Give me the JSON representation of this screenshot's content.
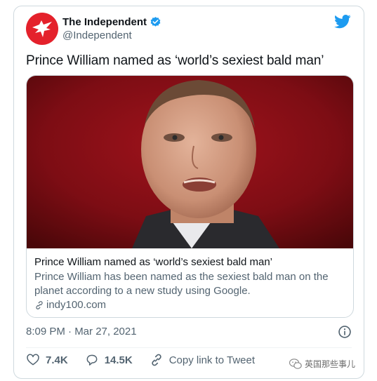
{
  "tweet": {
    "author_name": "The Independent",
    "handle": "@Independent",
    "text": "Prince William named as ‘world’s sexiest bald man’",
    "timestamp": "8:09 PM · Mar 27, 2021"
  },
  "link_card": {
    "title": "Prince William named as ‘world’s sexiest bald man’",
    "description": "Prince William has been named as the sexiest bald man on the planet according to a new study using Google.",
    "domain": "indy100.com"
  },
  "actions": {
    "likes": "7.4K",
    "replies": "14.5K",
    "copy_link_label": "Copy link to Tweet"
  },
  "watermark": {
    "text": "英国那些事儿"
  },
  "colors": {
    "brand_red": "#e4212b",
    "twitter_blue": "#1d9bf0",
    "muted_text": "#536471",
    "border": "#cfd9de"
  },
  "icons": [
    "independent-eagle-logo",
    "verified-badge-icon",
    "twitter-bird-icon",
    "link-icon",
    "info-icon",
    "heart-icon",
    "reply-icon",
    "copy-link-icon",
    "wechat-icon"
  ]
}
